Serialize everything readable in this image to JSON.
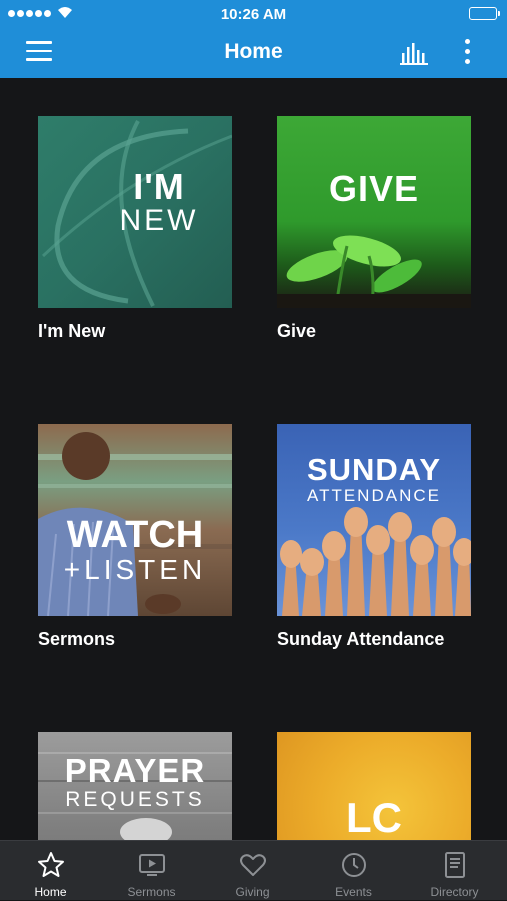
{
  "status_bar": {
    "time": "10:26 AM"
  },
  "header": {
    "title": "Home"
  },
  "tiles": [
    {
      "label": "I'm New",
      "image_title": "I'M",
      "image_subtitle": "NEW"
    },
    {
      "label": "Give",
      "image_title": "GIVE"
    },
    {
      "label": "Sermons",
      "image_title": "WATCH",
      "image_subtitle": "+LISTEN"
    },
    {
      "label": "Sunday Attendance",
      "image_title": "SUNDAY",
      "image_subtitle": "ATTENDANCE"
    },
    {
      "image_title": "PRAYER",
      "image_subtitle": "REQUESTS"
    },
    {
      "image_title": "LC"
    }
  ],
  "tab_bar": {
    "items": [
      {
        "label": "Home",
        "icon": "star-icon",
        "active": true
      },
      {
        "label": "Sermons",
        "icon": "play-screen-icon"
      },
      {
        "label": "Giving",
        "icon": "heart-icon"
      },
      {
        "label": "Events",
        "icon": "clock-icon"
      },
      {
        "label": "Directory",
        "icon": "book-icon"
      }
    ]
  },
  "colors": {
    "brand": "#1f8ed8",
    "background": "#151618",
    "tab_bar": "#2a2c2f"
  }
}
